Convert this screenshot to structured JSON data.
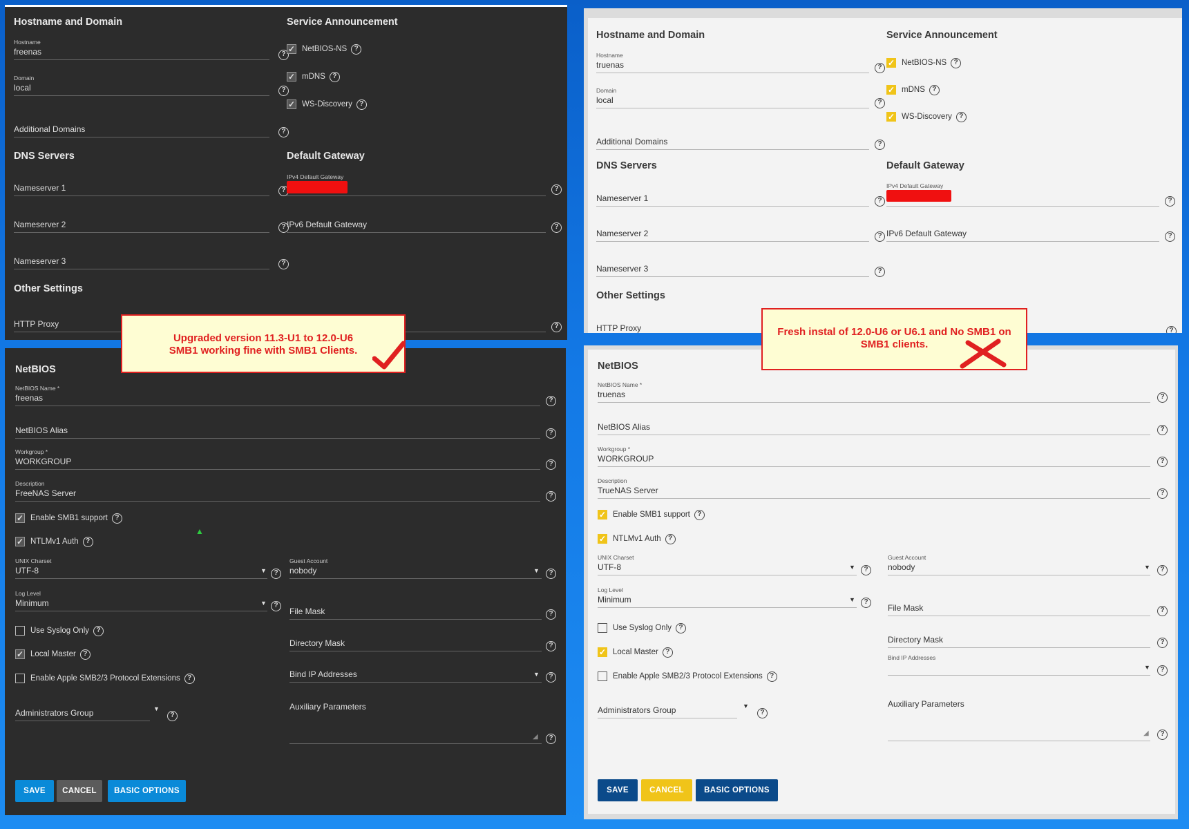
{
  "left": {
    "net": {
      "hostname_title": "Hostname and Domain",
      "hostname_label": "Hostname",
      "hostname_value": "freenas",
      "domain_label": "Domain",
      "domain_value": "local",
      "additional_domains": "Additional Domains",
      "dns_title": "DNS Servers",
      "ns1": "Nameserver 1",
      "ns2": "Nameserver 2",
      "ns3": "Nameserver 3",
      "other_title": "Other Settings",
      "http_proxy": "HTTP Proxy",
      "service_title": "Service Announcement",
      "netbios_ns": "NetBIOS-NS",
      "mdns": "mDNS",
      "ws_discovery": "WS-Discovery",
      "gateway_title": "Default Gateway",
      "ipv4_label": "IPv4 Default Gateway",
      "ipv6": "IPv6 Default Gateway"
    },
    "smb": {
      "title": "NetBIOS",
      "netbios_name_label": "NetBIOS Name *",
      "netbios_name_value": "freenas",
      "netbios_alias": "NetBIOS Alias",
      "workgroup_label": "Workgroup *",
      "workgroup_value": "WORKGROUP",
      "description_label": "Description",
      "description_value": "FreeNAS Server",
      "enable_smb1": "Enable SMB1 support",
      "ntlmv1": "NTLMv1 Auth",
      "unix_charset_label": "UNIX Charset",
      "unix_charset_value": "UTF-8",
      "log_level_label": "Log Level",
      "log_level_value": "Minimum",
      "use_syslog": "Use Syslog Only",
      "local_master": "Local Master",
      "apple_ext": "Enable Apple SMB2/3 Protocol Extensions",
      "admin_group": "Administrators Group",
      "guest_label": "Guest Account",
      "guest_value": "nobody",
      "file_mask": "File Mask",
      "dir_mask": "Directory Mask",
      "bind_ip": "Bind IP Addresses",
      "aux_params": "Auxiliary Parameters",
      "save": "SAVE",
      "cancel": "CANCEL",
      "basic": "BASIC OPTIONS"
    }
  },
  "right": {
    "net": {
      "hostname_title": "Hostname and Domain",
      "hostname_label": "Hostname",
      "hostname_value": "truenas",
      "domain_label": "Domain",
      "domain_value": "local",
      "additional_domains": "Additional Domains",
      "dns_title": "DNS Servers",
      "ns1": "Nameserver 1",
      "ns2": "Nameserver 2",
      "ns3": "Nameserver 3",
      "other_title": "Other Settings",
      "http_proxy": "HTTP Proxy",
      "service_title": "Service Announcement",
      "netbios_ns": "NetBIOS-NS",
      "mdns": "mDNS",
      "ws_discovery": "WS-Discovery",
      "gateway_title": "Default Gateway",
      "ipv4_label": "IPv4 Default Gateway",
      "ipv6": "IPv6 Default Gateway"
    },
    "smb": {
      "title": "NetBIOS",
      "netbios_name_label": "NetBIOS Name *",
      "netbios_name_value": "truenas",
      "netbios_alias": "NetBIOS Alias",
      "workgroup_label": "Workgroup *",
      "workgroup_value": "WORKGROUP",
      "description_label": "Description",
      "description_value": "TrueNAS Server",
      "enable_smb1": "Enable SMB1 support",
      "ntlmv1": "NTLMv1 Auth",
      "unix_charset_label": "UNIX Charset",
      "unix_charset_value": "UTF-8",
      "log_level_label": "Log Level",
      "log_level_value": "Minimum",
      "use_syslog": "Use Syslog Only",
      "local_master": "Local Master",
      "apple_ext": "Enable Apple SMB2/3 Protocol Extensions",
      "admin_group": "Administrators Group",
      "guest_label": "Guest Account",
      "guest_value": "nobody",
      "file_mask": "File Mask",
      "dir_mask": "Directory Mask",
      "bind_ip_label": "Bind IP Addresses",
      "aux_params": "Auxiliary Parameters",
      "save": "SAVE",
      "cancel": "CANCEL",
      "basic": "BASIC OPTIONS"
    }
  },
  "annotations": {
    "left_line1": "Upgraded version 11.3-U1 to 12.0-U6",
    "left_line2": "SMB1 working fine with SMB1 Clients.",
    "right_line1": "Fresh instal of 12.0-U6 or U6.1 and No SMB1 on",
    "right_line2": "SMB1 clients."
  },
  "colors": {
    "dark_bg": "#2c2c2c",
    "light_bg": "#f3f3f3",
    "save_blue": "#0a8ad8",
    "cancel_gray": "#5b5b5b",
    "truenas_blue": "#0b4a8a",
    "truenas_yellow": "#f0c419",
    "annotation_red": "#e02020",
    "annotation_bg": "#fefdd3"
  }
}
